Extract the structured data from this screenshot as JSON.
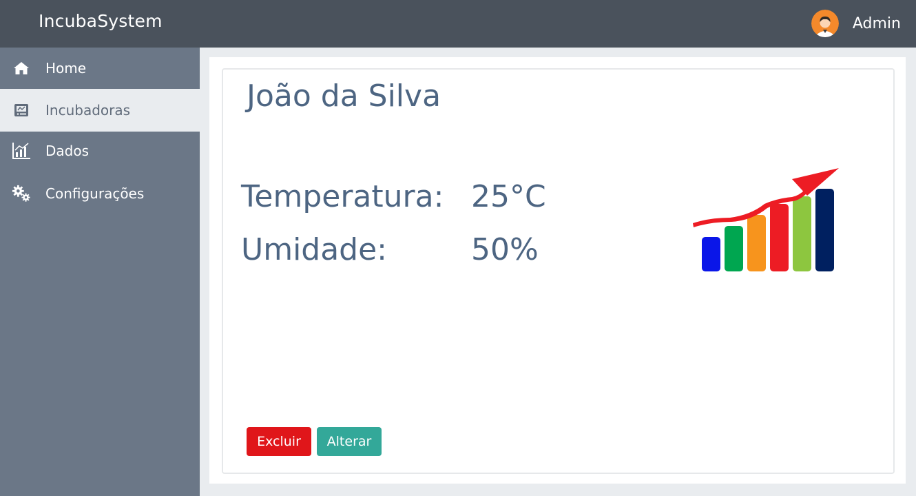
{
  "header": {
    "brand": "IncubaSystem",
    "user_name": "Admin",
    "avatar_icon": "user-avatar-icon",
    "bg_color": "#4a525c"
  },
  "sidebar": {
    "items": [
      {
        "label": "Home",
        "icon": "home-icon",
        "active": false
      },
      {
        "label": "Incubadoras",
        "icon": "incubator-icon",
        "active": true
      },
      {
        "label": "Dados",
        "icon": "bar-chart-icon",
        "active": false
      },
      {
        "label": "Configurações",
        "icon": "gears-icon",
        "active": false
      }
    ],
    "bg_color": "#6b7787"
  },
  "main": {
    "name": "João da Silva",
    "temperature_label": "Temperatura:",
    "temperature_value": "25°C",
    "humidity_label": "Umidade:",
    "humidity_value": "50%",
    "illustration_icon": "growth-chart-icon",
    "buttons": {
      "delete_label": "Excluir",
      "edit_label": "Alterar"
    },
    "colors": {
      "delete": "#e0161a",
      "edit": "#33a899",
      "text": "#4d6582"
    }
  }
}
